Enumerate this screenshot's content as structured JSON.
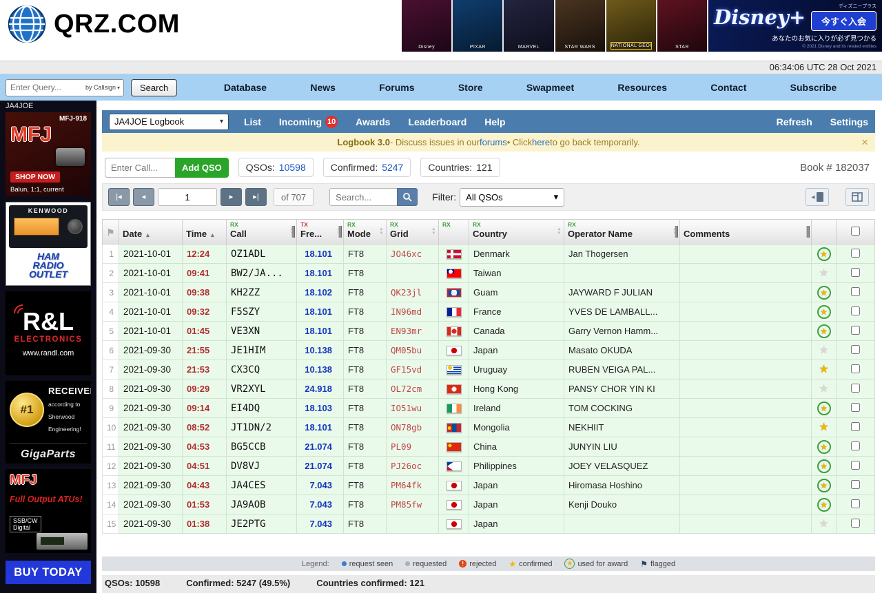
{
  "header": {
    "logo_text": "QRZ.COM",
    "ad": {
      "panels": [
        {
          "label": "Disney",
          "bg1": "#4a1030",
          "bg2": "#1c0616"
        },
        {
          "label": "PIXAR",
          "bg1": "#0f3d6e",
          "bg2": "#071a30"
        },
        {
          "label": "MARVEL",
          "bg1": "#23243e",
          "bg2": "#0d0e1c"
        },
        {
          "label": "STAR WARS",
          "bg1": "#4a3420",
          "bg2": "#17100a"
        },
        {
          "label": "NATIONAL GEOGRAPHIC",
          "bg1": "#6e5a1a",
          "bg2": "#2a2208"
        },
        {
          "label": "STAR",
          "bg1": "#5e1220",
          "bg2": "#1e060c"
        }
      ],
      "brand": "Disney+",
      "brand_note": "ディズニープラス",
      "cta": "今すぐ入会",
      "tagline": "あなたのお気に入りが必ず見つかる",
      "fineprint": "© 2021 Disney and its related entities"
    }
  },
  "utc_bar": {
    "datetime": "06:34:06 UTC 28 Oct 2021"
  },
  "nav": {
    "query_placeholder": "Enter Query...",
    "query_by": "by Callsign",
    "search_button": "Search",
    "items": [
      "Database",
      "News",
      "Forums",
      "Store",
      "Swapmeet",
      "Resources",
      "Contact",
      "Subscribe"
    ]
  },
  "sidebar": {
    "callsign": "JA4JOE",
    "ads": {
      "mfj918": {
        "brand": "MFJ",
        "model": "MFJ-918",
        "cta": "SHOP NOW",
        "caption": "Balun, 1:1, current"
      },
      "kenwood": {
        "brand": "KENWOOD",
        "store_line1": "HAM",
        "store_line2": "RADIO",
        "store_line3": "OUTLET"
      },
      "randl": {
        "brand": "R&L",
        "name": "ELECTRONICS",
        "url": "www.randl.com"
      },
      "gigaparts": {
        "rank": "#1",
        "title": "RECEIVER",
        "sub1": "according to",
        "sub2": "Sherwood",
        "sub3": "Engineering!",
        "brand": "GigaParts"
      },
      "mfjatu": {
        "brand": "MFJ",
        "title": "Full Output ATUs!",
        "sub1": "SSB/CW",
        "sub2": "Digital"
      }
    },
    "buy_today": "BUY TODAY"
  },
  "logbook": {
    "toolbar": {
      "book_select": "JA4JOE Logbook",
      "tabs": [
        {
          "label": "List"
        },
        {
          "label": "Incoming",
          "badge": "10"
        },
        {
          "label": "Awards"
        },
        {
          "label": "Leaderboard"
        },
        {
          "label": "Help"
        }
      ],
      "actions": [
        "Refresh",
        "Settings"
      ]
    },
    "notice": {
      "title": "Logbook 3.0",
      "part1": " - Discuss issues in our ",
      "link_forums": "forums",
      "part2": " • Click ",
      "link_here": "here",
      "part3": " to go back temporarily."
    },
    "stats": {
      "call_placeholder": "Enter Call...",
      "add_qso": "Add QSO",
      "qsos_label": "QSOs:",
      "qsos_value": "10598",
      "confirmed_label": "Confirmed:",
      "confirmed_value": "5247",
      "countries_label": "Countries:",
      "countries_value": "121",
      "book_number": "Book # 182037"
    },
    "pagination": {
      "page_value": "1",
      "of_text": "of 707",
      "search_placeholder": "Search...",
      "filter_label": "Filter:",
      "filter_value": "All QSOs"
    },
    "table": {
      "columns": [
        {
          "id": "num",
          "label": "",
          "sortable": false
        },
        {
          "id": "date",
          "label": "Date",
          "sort": "asc",
          "sortable": true
        },
        {
          "id": "time",
          "label": "Time",
          "sort": "asc",
          "sortable": true
        },
        {
          "id": "call",
          "prefix": "RX",
          "label": "Call",
          "sort": "both",
          "handle": true,
          "sortable": true
        },
        {
          "id": "freq",
          "prefix": "TX",
          "label": "Fre...",
          "sort": "both",
          "handle": true,
          "sortable": true
        },
        {
          "id": "mode",
          "prefix": "RX",
          "label": "Mode",
          "sort": "both",
          "sortable": true
        },
        {
          "id": "grid",
          "prefix": "RX",
          "label": "Grid",
          "sort": "both",
          "sortable": true
        },
        {
          "id": "flag2",
          "prefix": "RX",
          "label": "",
          "sortable": false
        },
        {
          "id": "country",
          "prefix": "RX",
          "label": "Country",
          "sort": "both",
          "sortable": true
        },
        {
          "id": "operator",
          "prefix": "RX",
          "label": "Operator Name",
          "sort": "both",
          "handle": true,
          "sortable": true
        },
        {
          "id": "comments",
          "label": "Comments",
          "handle": true,
          "sortable": false
        },
        {
          "id": "star",
          "label": "",
          "sortable": false
        },
        {
          "id": "check",
          "label": "",
          "sortable": false
        }
      ],
      "rows": [
        {
          "num": "1",
          "date": "2021-10-01",
          "time": "12:24",
          "call": "OZ1ADL",
          "freq": "18.101",
          "mode": "FT8",
          "grid": "JO46xc",
          "flag": "dk",
          "country": "Denmark",
          "operator": "Jan Thogersen",
          "comments": "",
          "star": "award"
        },
        {
          "num": "2",
          "date": "2021-10-01",
          "time": "09:41",
          "call": "BW2/JA...",
          "freq": "18.101",
          "mode": "FT8",
          "grid": "",
          "flag": "tw",
          "country": "Taiwan",
          "operator": "",
          "comments": "",
          "star": "none"
        },
        {
          "num": "3",
          "date": "2021-10-01",
          "time": "09:38",
          "call": "KH2ZZ",
          "freq": "18.102",
          "mode": "FT8",
          "grid": "QK23jl",
          "flag": "gu",
          "country": "Guam",
          "operator": "JAYWARD F JULIAN",
          "comments": "",
          "star": "award"
        },
        {
          "num": "4",
          "date": "2021-10-01",
          "time": "09:32",
          "call": "F5SZY",
          "freq": "18.101",
          "mode": "FT8",
          "grid": "IN96md",
          "flag": "fr",
          "country": "France",
          "operator": "YVES DE LAMBALL...",
          "comments": "",
          "star": "award"
        },
        {
          "num": "5",
          "date": "2021-10-01",
          "time": "01:45",
          "call": "VE3XN",
          "freq": "18.101",
          "mode": "FT8",
          "grid": "EN93mr",
          "flag": "ca",
          "country": "Canada",
          "operator": "Garry Vernon Hamm...",
          "comments": "",
          "star": "award"
        },
        {
          "num": "6",
          "date": "2021-09-30",
          "time": "21:55",
          "call": "JE1HIM",
          "freq": "10.138",
          "mode": "FT8",
          "grid": "QM05bu",
          "flag": "jp",
          "country": "Japan",
          "operator": "Masato OKUDA",
          "comments": "",
          "star": "none"
        },
        {
          "num": "7",
          "date": "2021-09-30",
          "time": "21:53",
          "call": "CX3CQ",
          "freq": "10.138",
          "mode": "FT8",
          "grid": "GF15vd",
          "flag": "uy",
          "country": "Uruguay",
          "operator": "RUBEN VEIGA PAL...",
          "comments": "",
          "star": "confirmed"
        },
        {
          "num": "8",
          "date": "2021-09-30",
          "time": "09:29",
          "call": "VR2XYL",
          "freq": "24.918",
          "mode": "FT8",
          "grid": "OL72cm",
          "flag": "hk",
          "country": "Hong Kong",
          "operator": "PANSY CHOR YIN KI",
          "comments": "",
          "star": "none"
        },
        {
          "num": "9",
          "date": "2021-09-30",
          "time": "09:14",
          "call": "EI4DQ",
          "freq": "18.103",
          "mode": "FT8",
          "grid": "IO51wu",
          "flag": "ie",
          "country": "Ireland",
          "operator": "TOM COCKING",
          "comments": "",
          "star": "award"
        },
        {
          "num": "10",
          "date": "2021-09-30",
          "time": "08:52",
          "call": "JT1DN/2",
          "freq": "18.101",
          "mode": "FT8",
          "grid": "ON78gb",
          "flag": "mn",
          "country": "Mongolia",
          "operator": "NEKHIIT",
          "comments": "",
          "star": "confirmed"
        },
        {
          "num": "11",
          "date": "2021-09-30",
          "time": "04:53",
          "call": "BG5CCB",
          "freq": "21.074",
          "mode": "FT8",
          "grid": "PL09",
          "flag": "cn",
          "country": "China",
          "operator": "JUNYIN LIU",
          "comments": "",
          "star": "award"
        },
        {
          "num": "12",
          "date": "2021-09-30",
          "time": "04:51",
          "call": "DV8VJ",
          "freq": "21.074",
          "mode": "FT8",
          "grid": "PJ26oc",
          "flag": "ph",
          "country": "Philippines",
          "operator": "JOEY VELASQUEZ",
          "comments": "",
          "star": "award"
        },
        {
          "num": "13",
          "date": "2021-09-30",
          "time": "04:43",
          "call": "JA4CES",
          "freq": "7.043",
          "mode": "FT8",
          "grid": "PM64fk",
          "flag": "jp",
          "country": "Japan",
          "operator": "Hiromasa Hoshino",
          "comments": "",
          "star": "award"
        },
        {
          "num": "14",
          "date": "2021-09-30",
          "time": "01:53",
          "call": "JA9AOB",
          "freq": "7.043",
          "mode": "FT8",
          "grid": "PM85fw",
          "flag": "jp",
          "country": "Japan",
          "operator": "Kenji Douko",
          "comments": "",
          "star": "award"
        },
        {
          "num": "15",
          "date": "2021-09-30",
          "time": "01:38",
          "call": "JE2PTG",
          "freq": "7.043",
          "mode": "FT8",
          "grid": "",
          "flag": "jp",
          "country": "Japan",
          "operator": "",
          "comments": "",
          "star": "none"
        }
      ]
    },
    "legend": {
      "label": "Legend:",
      "items": [
        {
          "icon": "request-seen",
          "label": "request seen"
        },
        {
          "icon": "requested",
          "label": "requested"
        },
        {
          "icon": "rejected",
          "label": "rejected"
        },
        {
          "icon": "confirmed",
          "label": "confirmed"
        },
        {
          "icon": "used-for-award",
          "label": "used for award"
        },
        {
          "icon": "flagged",
          "label": "flagged"
        }
      ]
    },
    "footer": {
      "qsos": "QSOs: 10598",
      "confirmed": "Confirmed: 5247 (49.5%)",
      "countries": "Countries confirmed: 121"
    }
  },
  "icons": {
    "first_page": "|◂",
    "prev_page": "◂",
    "next_page": "▸",
    "last_page": "▸|",
    "caret_down": "▾",
    "close": "×",
    "sort_asc": "▴",
    "sort_desc": "▾",
    "flag_header": "⚑",
    "flag_legend": "⚑",
    "star": "★",
    "rejected_mark": "!"
  },
  "colors": {
    "toolbar_blue": "#4a7dad",
    "nav_blue": "#a7d1f3",
    "notice_bg": "#faf3cd",
    "add_qso_green": "#2aa52a",
    "row_green": "#eafaea",
    "badge_red": "#e03030"
  }
}
